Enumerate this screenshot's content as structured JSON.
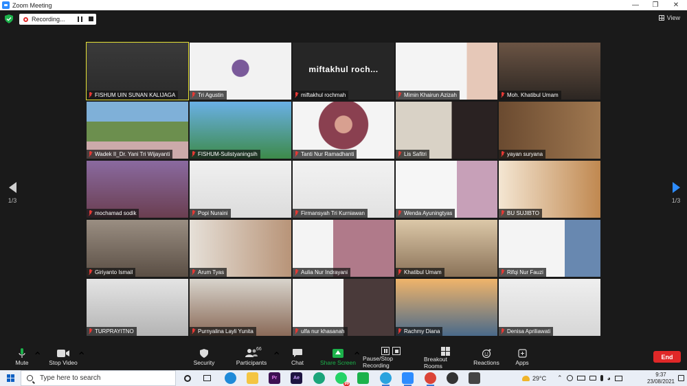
{
  "window": {
    "title": "Zoom Meeting"
  },
  "recording": {
    "label": "Recording..."
  },
  "view_label": "View",
  "nav": {
    "page_left": "1/3",
    "page_right": "1/3"
  },
  "participants": [
    {
      "name": "FISHUM UIN SUNAN KALIJAGA",
      "muted": true,
      "active": true
    },
    {
      "name": "Tri Agustin",
      "muted": true
    },
    {
      "name": "miftakhul rochmah",
      "muted": true,
      "display_name": "miftakhul  roch..."
    },
    {
      "name": "Mimin Khairun Azizah",
      "muted": true
    },
    {
      "name": "Moh. Khatibul Umam",
      "muted": true
    },
    {
      "name": "Wadek II_Dr. Yani Tri Wijayanti",
      "muted": true
    },
    {
      "name": "FISHUM-Sulistyaningsih",
      "muted": true
    },
    {
      "name": "Tanti Nur Ramadhanti",
      "muted": true
    },
    {
      "name": "Lis Safitri",
      "muted": true
    },
    {
      "name": "yayan suryana",
      "muted": true
    },
    {
      "name": "mochamad sodik",
      "muted": true
    },
    {
      "name": "Popi Nuraini",
      "muted": true
    },
    {
      "name": "Firmansyah Tri Kurniawan",
      "muted": true
    },
    {
      "name": "Wenda Ayuningtyas",
      "muted": true
    },
    {
      "name": "BU SUJIBTO",
      "muted": true
    },
    {
      "name": "Giriyanto Ismail",
      "muted": true
    },
    {
      "name": "Arum Tyas",
      "muted": true
    },
    {
      "name": "Aulia Nur Indrayani",
      "muted": true
    },
    {
      "name": "Khatibul Umam",
      "muted": true
    },
    {
      "name": "Rifqi Nur Fauzi",
      "muted": true
    },
    {
      "name": "TURPRAYITNO",
      "muted": true
    },
    {
      "name": "Purnyalina Layli Yunita",
      "muted": true
    },
    {
      "name": "ulfa nur khasanah",
      "muted": true
    },
    {
      "name": "Rachmy Diana",
      "muted": true
    },
    {
      "name": "Denisa Apriliawati",
      "muted": true
    }
  ],
  "toolbar": {
    "mute": "Mute",
    "stop_video": "Stop Video",
    "security": "Security",
    "participants": "Participants",
    "participants_count": "66",
    "chat": "Chat",
    "share_screen": "Share Screen",
    "pause_stop_recording": "Pause/Stop Recording",
    "breakout_rooms": "Breakout Rooms",
    "reactions": "Reactions",
    "apps": "Apps",
    "end": "End"
  },
  "taskbar": {
    "search_placeholder": "Type here to search",
    "temperature": "29°C",
    "time": "9:37",
    "date": "23/08/2021",
    "badge_whatsapp": "99"
  },
  "colors": {
    "accent_blue": "#2d8cff",
    "end_red": "#e02828",
    "share_green": "#1cb24b",
    "active_border": "#e8e437"
  }
}
